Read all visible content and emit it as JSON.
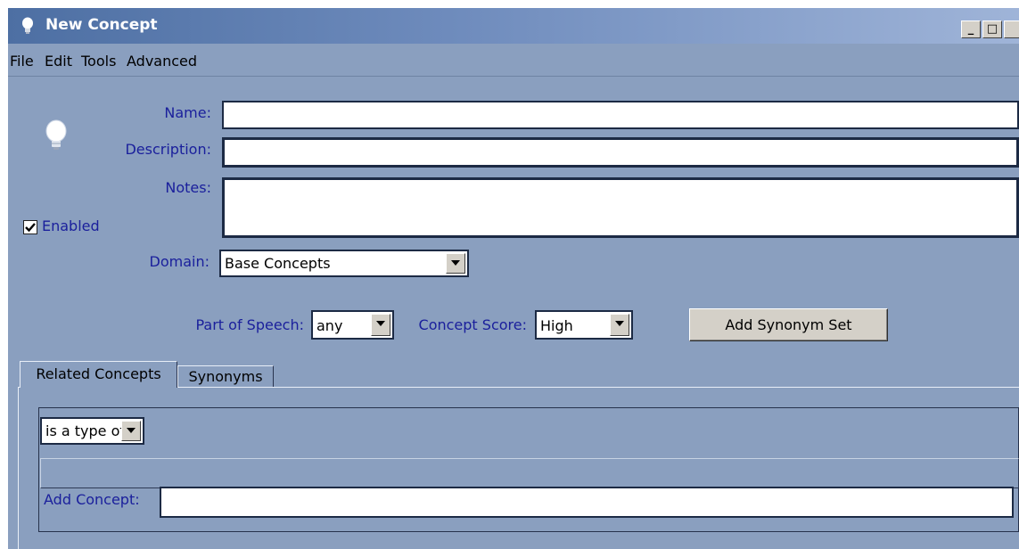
{
  "window": {
    "title": "New Concept",
    "controls": {
      "minimize": "_",
      "maximize": "□"
    }
  },
  "menu": [
    "File",
    "Edit",
    "Tools",
    "Advanced"
  ],
  "form": {
    "name_label": "Name:",
    "name_value": "",
    "description_label": "Description:",
    "description_value": "",
    "notes_label": "Notes:",
    "notes_value": "",
    "enabled_label": "Enabled",
    "enabled_checked": true,
    "domain_label": "Domain:",
    "domain_value": "Base Concepts",
    "part_of_speech_label": "Part of Speech:",
    "part_of_speech_value": "any",
    "concept_score_label": "Concept Score:",
    "concept_score_value": "High",
    "add_synonym_set_label": "Add Synonym Set"
  },
  "tabs": [
    {
      "label": "Related Concepts",
      "active": true
    },
    {
      "label": "Synonyms",
      "active": false
    }
  ],
  "related": {
    "relation_value": "is a type of",
    "add_concept_label": "Add Concept:",
    "add_concept_value": ""
  },
  "icons": {
    "app": "lightbulb-icon",
    "concept": "lightbulb-icon"
  }
}
